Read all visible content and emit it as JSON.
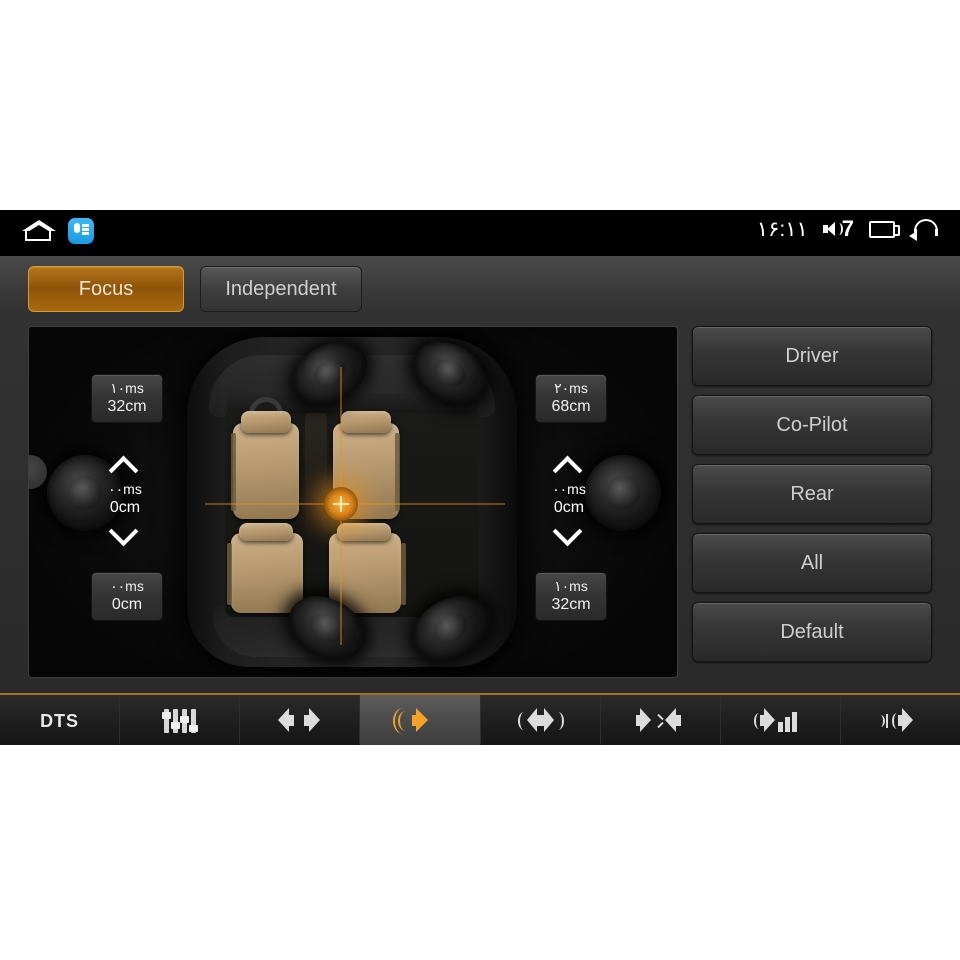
{
  "statusbar": {
    "home_icon": "home-icon",
    "app_icon": "equalizer-app-icon",
    "clock": "۱۶:۱۱",
    "volume_icon": "volume-icon",
    "volume_level": "7",
    "recents_icon": "recent-apps-icon",
    "back_icon": "back-arrow-icon"
  },
  "tabs": [
    {
      "id": "focus",
      "label": "Focus",
      "active": true
    },
    {
      "id": "independent",
      "label": "Independent",
      "active": false
    }
  ],
  "car_panel": {
    "title": "sound-field-positioning",
    "focus_point_icon": "focus-crosshair-marker",
    "edge_handle_icon": "edge-drag-handle",
    "speakers": [
      {
        "position": "front-left",
        "delay": "۱۰ms",
        "distance": "32cm",
        "type": "chip"
      },
      {
        "position": "front-right",
        "delay": "۲۰ms",
        "distance": "68cm",
        "type": "chip"
      },
      {
        "position": "mid-left",
        "delay": "۰۰ms",
        "distance": "0cm",
        "type": "stepper"
      },
      {
        "position": "mid-right",
        "delay": "۰۰ms",
        "distance": "0cm",
        "type": "stepper"
      },
      {
        "position": "rear-left",
        "delay": "۰۰ms",
        "distance": "0cm",
        "type": "chip"
      },
      {
        "position": "rear-right",
        "delay": "۱۰ms",
        "distance": "32cm",
        "type": "chip"
      }
    ],
    "stepper_up_icon": "chevron-up-icon",
    "stepper_down_icon": "chevron-down-icon"
  },
  "presets": [
    {
      "id": "driver",
      "label": "Driver"
    },
    {
      "id": "copilot",
      "label": "Co-Pilot"
    },
    {
      "id": "rear",
      "label": "Rear"
    },
    {
      "id": "all",
      "label": "All"
    },
    {
      "id": "default",
      "label": "Default"
    }
  ],
  "toolbar": [
    {
      "id": "dts",
      "label": "DTS",
      "icon": "dts-logo",
      "active": false
    },
    {
      "id": "equalizer",
      "label": "",
      "icon": "equalizer-sliders-icon",
      "active": false
    },
    {
      "id": "balance",
      "label": "",
      "icon": "balance-speakers-icon",
      "active": false
    },
    {
      "id": "focus",
      "label": "",
      "icon": "focus-speaker-icon",
      "active": true
    },
    {
      "id": "surround",
      "label": "",
      "icon": "surround-speaker-icon",
      "active": false
    },
    {
      "id": "fader",
      "label": "",
      "icon": "fader-speakers-icon",
      "active": false
    },
    {
      "id": "levels",
      "label": "",
      "icon": "speaker-levels-icon",
      "active": false
    },
    {
      "id": "crossover",
      "label": "",
      "icon": "crossover-speaker-icon",
      "active": false
    }
  ],
  "colors": {
    "accent": "#d7901f",
    "toolbar_rule": "#9a7328",
    "panel_bg": "#2f2f2f",
    "button_text": "#cfcfcf"
  }
}
